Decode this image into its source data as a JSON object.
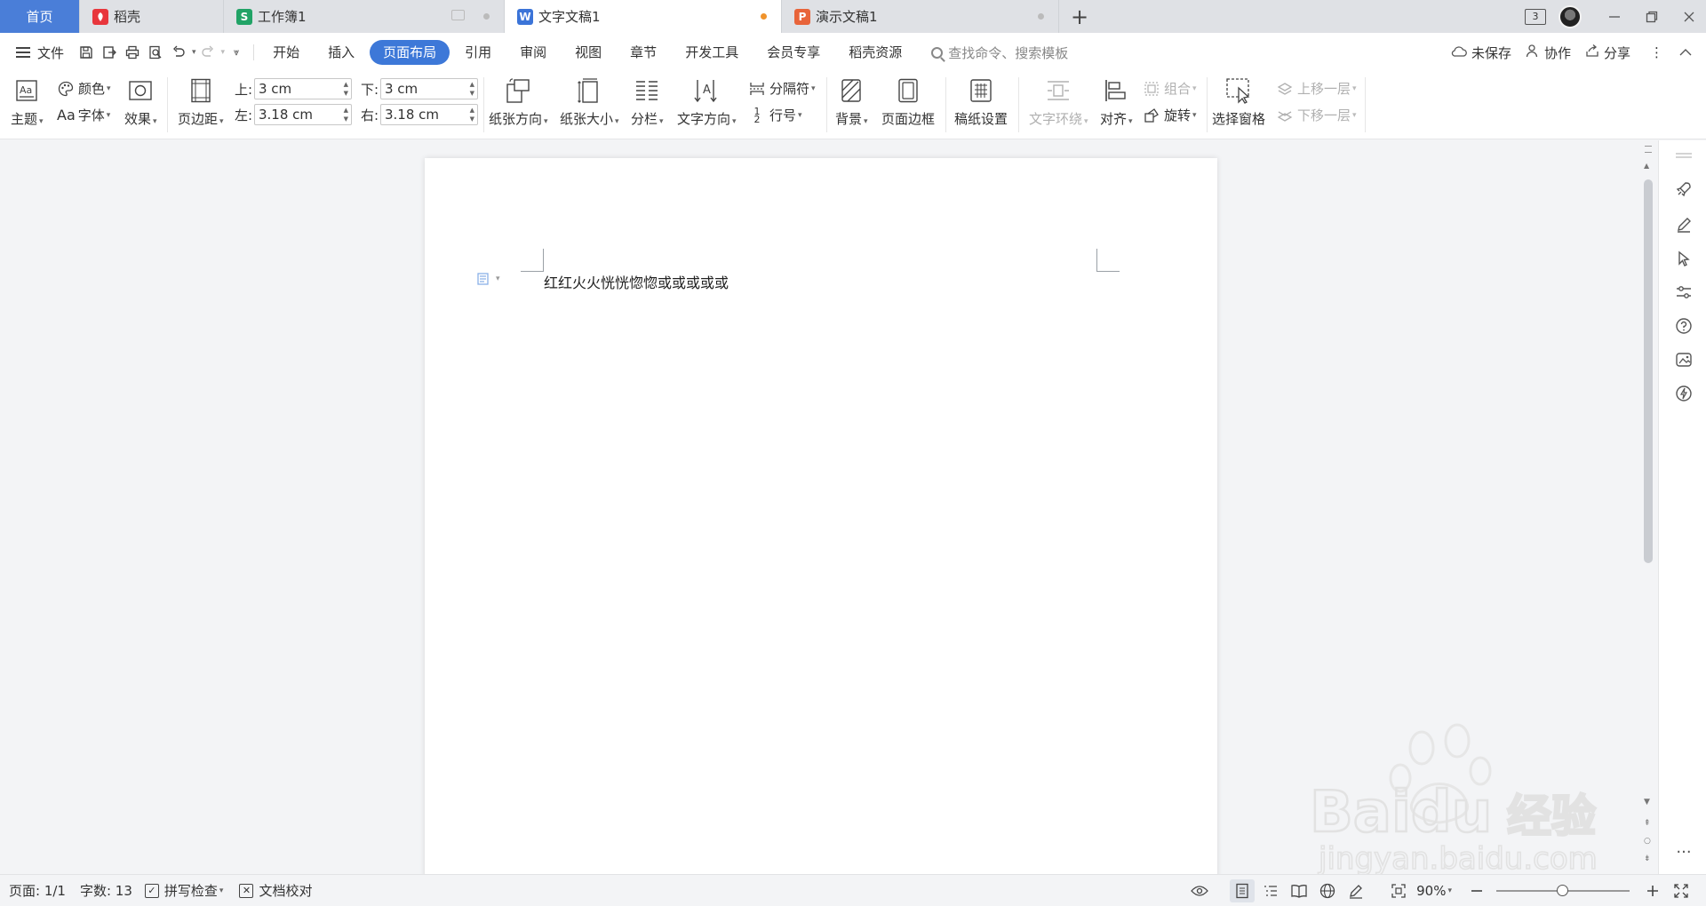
{
  "tabs": [
    {
      "label": "首页",
      "icon": "home"
    },
    {
      "label": "稻壳",
      "icon": "docer-icon",
      "color": "#e8363c"
    },
    {
      "label": "工作簿1",
      "icon": "spreadsheet-icon",
      "color": "#21a366"
    },
    {
      "label": "文字文稿1",
      "icon": "writer-icon",
      "color": "#3b74d8",
      "active": true,
      "unsaved": true
    },
    {
      "label": "演示文稿1",
      "icon": "presentation-icon",
      "color": "#e8643a"
    }
  ],
  "window": {
    "badge": "3"
  },
  "menubar": {
    "file": "文件",
    "tabs": [
      "开始",
      "插入",
      "页面布局",
      "引用",
      "审阅",
      "视图",
      "章节",
      "开发工具",
      "会员专享",
      "稻壳资源"
    ],
    "active_tab": "页面布局",
    "search_placeholder": "查找命令、搜索模板",
    "unsaved": "未保存",
    "collab": "协作",
    "share": "分享"
  },
  "ribbon": {
    "theme": "主题",
    "color": "颜色",
    "font": "字体",
    "effect": "效果",
    "margins": "页边距",
    "margin_top_label": "上:",
    "margin_top": "3 cm",
    "margin_bottom_label": "下:",
    "margin_bottom": "3 cm",
    "margin_left_label": "左:",
    "margin_left": "3.18 cm",
    "margin_right_label": "右:",
    "margin_right": "3.18 cm",
    "orientation": "纸张方向",
    "size": "纸张大小",
    "columns": "分栏",
    "text_direction": "文字方向",
    "breaks": "分隔符",
    "line_numbers": "行号",
    "background": "背景",
    "page_border": "页面边框",
    "manuscript": "稿纸设置",
    "wrap_text": "文字环绕",
    "align": "对齐",
    "group": "组合",
    "rotate": "旋转",
    "selection_pane": "选择窗格",
    "bring_forward": "上移一层",
    "send_backward": "下移一层"
  },
  "document": {
    "text": "红红火火恍恍惚惚或或或或或"
  },
  "statusbar": {
    "page": "页面: 1/1",
    "words": "字数: 13",
    "spell_check": "拼写检查",
    "proofread": "文档校对",
    "zoom": "90%"
  },
  "watermark": {
    "brand": "Baidu",
    "brand_cn": "经验",
    "url": "jingyan.baidu.com"
  },
  "colors": {
    "accent": "#3d78d8",
    "home_tab": "#4a7ed8",
    "unsaved_dot": "#f0932b"
  }
}
